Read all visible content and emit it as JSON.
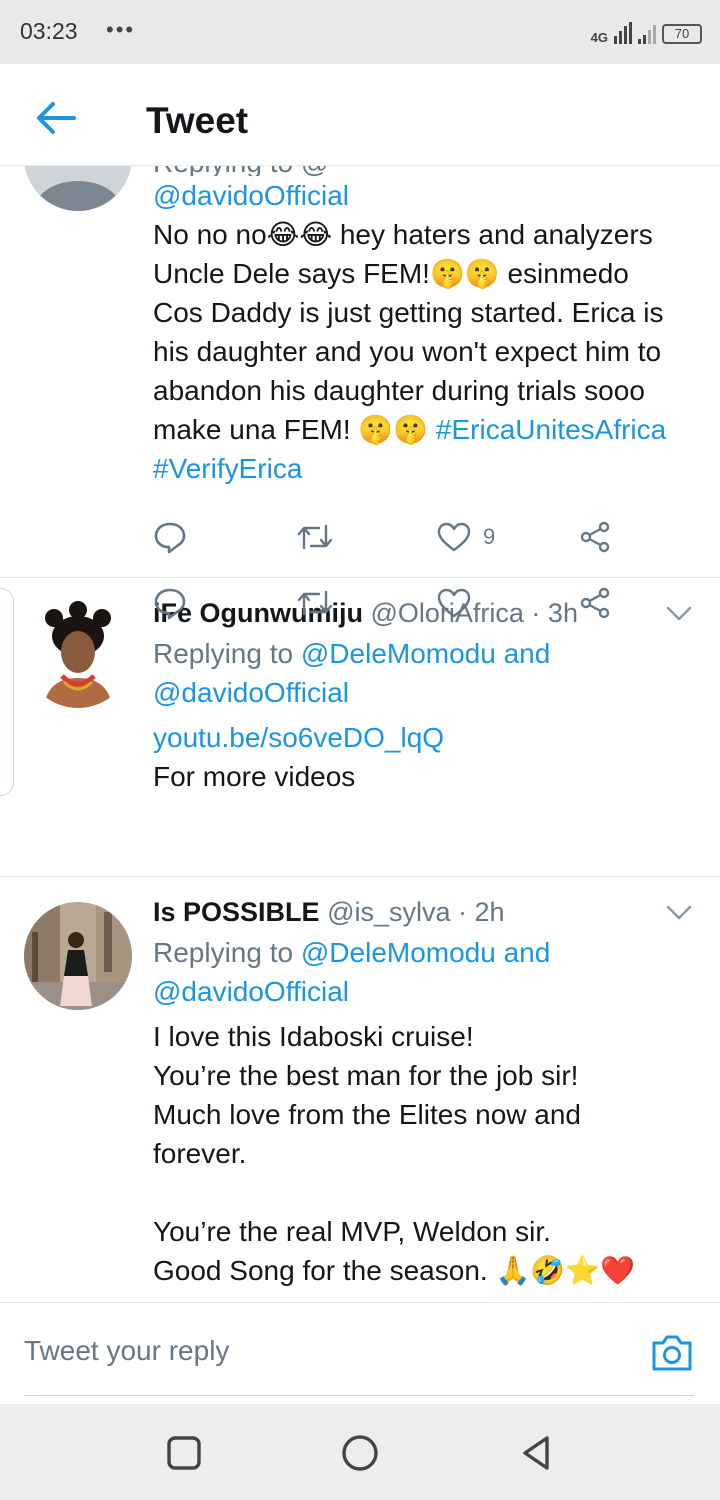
{
  "status_bar": {
    "time": "03:23",
    "dots": "•••",
    "network": "4G",
    "battery": "70"
  },
  "header": {
    "title": "Tweet",
    "back_icon": "arrow-left-icon"
  },
  "tweets": [
    {
      "reply_partial": "Replying to @",
      "reply_handle2": "@davidoOfficial",
      "text_lines": [
        "No no  no😂😂 hey haters and analyzers",
        "Uncle Dele says FEM!🤫🤫 esinmedo",
        "Cos Daddy is just getting started. Erica is",
        "his daughter and you won't expect him to",
        "abandon his daughter during trials sooo"
      ],
      "last_line_prefix": "make una FEM! 🤫🤫 ",
      "hashtag1": "#EricaUnitesAfrica",
      "hashtag2": "#VerifyErica",
      "likes": "9"
    },
    {
      "name": "iFe Ogunwumiju",
      "handle_time": " @OloriAfrica · 3h",
      "replying_prefix": "Replying to ",
      "reply_handle1": "@DeleMomodu and",
      "reply_handle2": "@davidoOfficial",
      "link": "youtu.be/so6veDO_lqQ",
      "text": "For more videos"
    },
    {
      "name": "Is POSSIBLE",
      "handle_time": " @is_sylva · 2h",
      "replying_prefix": "Replying to ",
      "reply_handle1": "@DeleMomodu and",
      "reply_handle2": "@davidoOfficial",
      "text_lines": [
        "I love this Idaboski cruise!",
        "You’re the best man for the job sir!",
        "Much love from the Elites now and",
        "forever.",
        "",
        "You’re the real MVP, Weldon sir.",
        "Good Song for the season. 🙏🤣⭐❤️"
      ]
    }
  ],
  "reply_bar": {
    "placeholder": "Tweet your reply",
    "camera_icon": "camera-icon"
  },
  "colors": {
    "accent": "#1b95e0",
    "secondary_text": "#657786",
    "primary_text": "#14171a"
  }
}
